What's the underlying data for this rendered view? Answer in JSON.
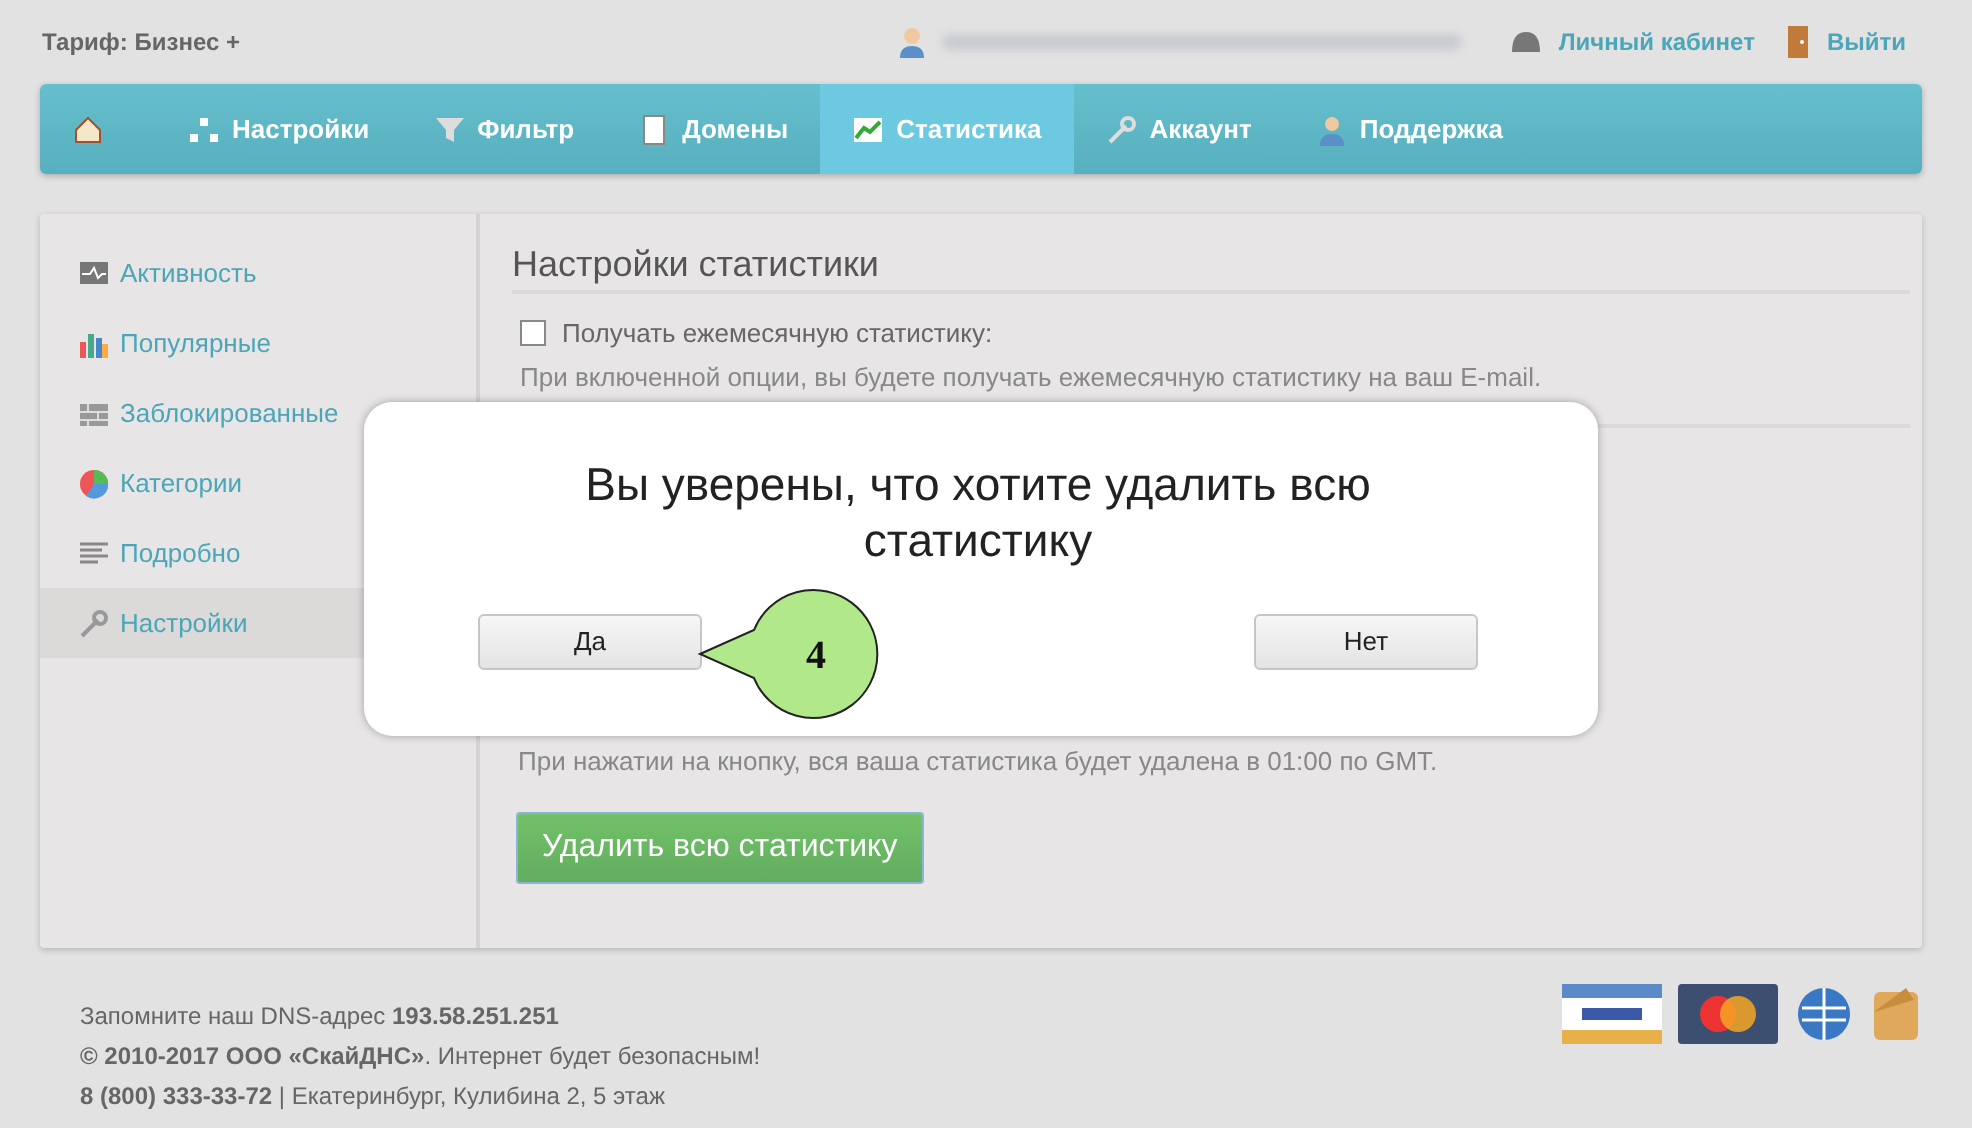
{
  "top_bar": {
    "plan": "Тариф: Бизнес +",
    "account_link": "Личный кабинет",
    "logout_link": "Выйти"
  },
  "nav": {
    "tabs": [
      {
        "kind": "home",
        "selected": false
      },
      {
        "kind": "settings",
        "label": "Настройки",
        "selected": false
      },
      {
        "kind": "filter",
        "label": "Фильтр",
        "selected": false
      },
      {
        "kind": "domains",
        "label": "Домены",
        "selected": false
      },
      {
        "kind": "stats",
        "label": "Статистика",
        "selected": true
      },
      {
        "kind": "account",
        "label": "Аккаунт",
        "selected": false
      },
      {
        "kind": "support",
        "label": "Поддержка",
        "selected": false
      }
    ]
  },
  "sidebar": {
    "items": [
      {
        "kind": "activity",
        "label": "Активность",
        "selected": false
      },
      {
        "kind": "popular",
        "label": "Популярные",
        "selected": false
      },
      {
        "kind": "blocked",
        "label": "Заблокированные",
        "selected": false
      },
      {
        "kind": "categories",
        "label": "Категории",
        "selected": false
      },
      {
        "kind": "details",
        "label": "Подробно",
        "selected": false
      },
      {
        "kind": "settings",
        "label": "Настройки",
        "selected": true
      }
    ]
  },
  "content": {
    "title": "Настройки статистики",
    "option": {
      "label": "Получать ежемесячную статистику:",
      "checked": false,
      "description": "При включенной опции, вы будете получать ежемесячную статистику на ваш E-mail."
    },
    "delete_note": "При нажатии на кнопку, вся ваша статистика будет удалена в 01:00 по GMT.",
    "delete_button": "Удалить всю статистику"
  },
  "modal": {
    "message": "Вы уверены, что хотите удалить всю статистику",
    "buttons": [
      "Да",
      "Нет"
    ],
    "callout": "4"
  },
  "footer": {
    "lines": [
      "Запомните наш DNS-адрес **193.58.251.251**",
      "**© 2010-2017 ООО «СкайДНС»**. Интернет будет безопасным!",
      "**8 (800) 333-33-72** | Екатеринбург, Кулибина 2, 5 этаж"
    ]
  }
}
